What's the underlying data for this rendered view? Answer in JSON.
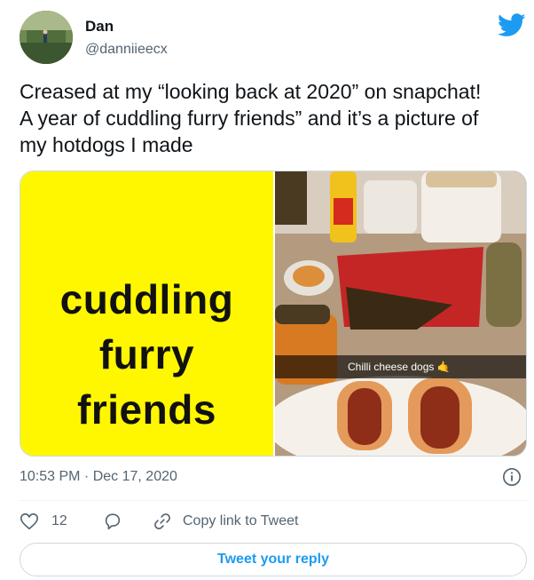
{
  "user": {
    "name": "Dan",
    "handle": "@danniieecx"
  },
  "tweet": {
    "text": "Creased at my “looking back at 2020” on snapchat!\nA year of cuddling furry friends” and it’s a picture of\nmy hotdogs I made",
    "timestamp": "10:53 PM · Dec 17, 2020"
  },
  "media": {
    "left_text_lines": [
      "cuddling",
      "furry",
      "friends"
    ],
    "left_bg": "#fff700",
    "snap_caption": "Chilli cheese dogs 🤙"
  },
  "actions": {
    "like_count": "12",
    "copy_link_label": "Copy link to Tweet",
    "reply_button_label": "Tweet your reply"
  },
  "colors": {
    "accent": "#1d9bf0",
    "muted": "#536471",
    "text": "#0f1419"
  },
  "icons": [
    "twitter-bird-icon",
    "heart-icon",
    "reply-icon",
    "link-icon",
    "info-icon"
  ]
}
